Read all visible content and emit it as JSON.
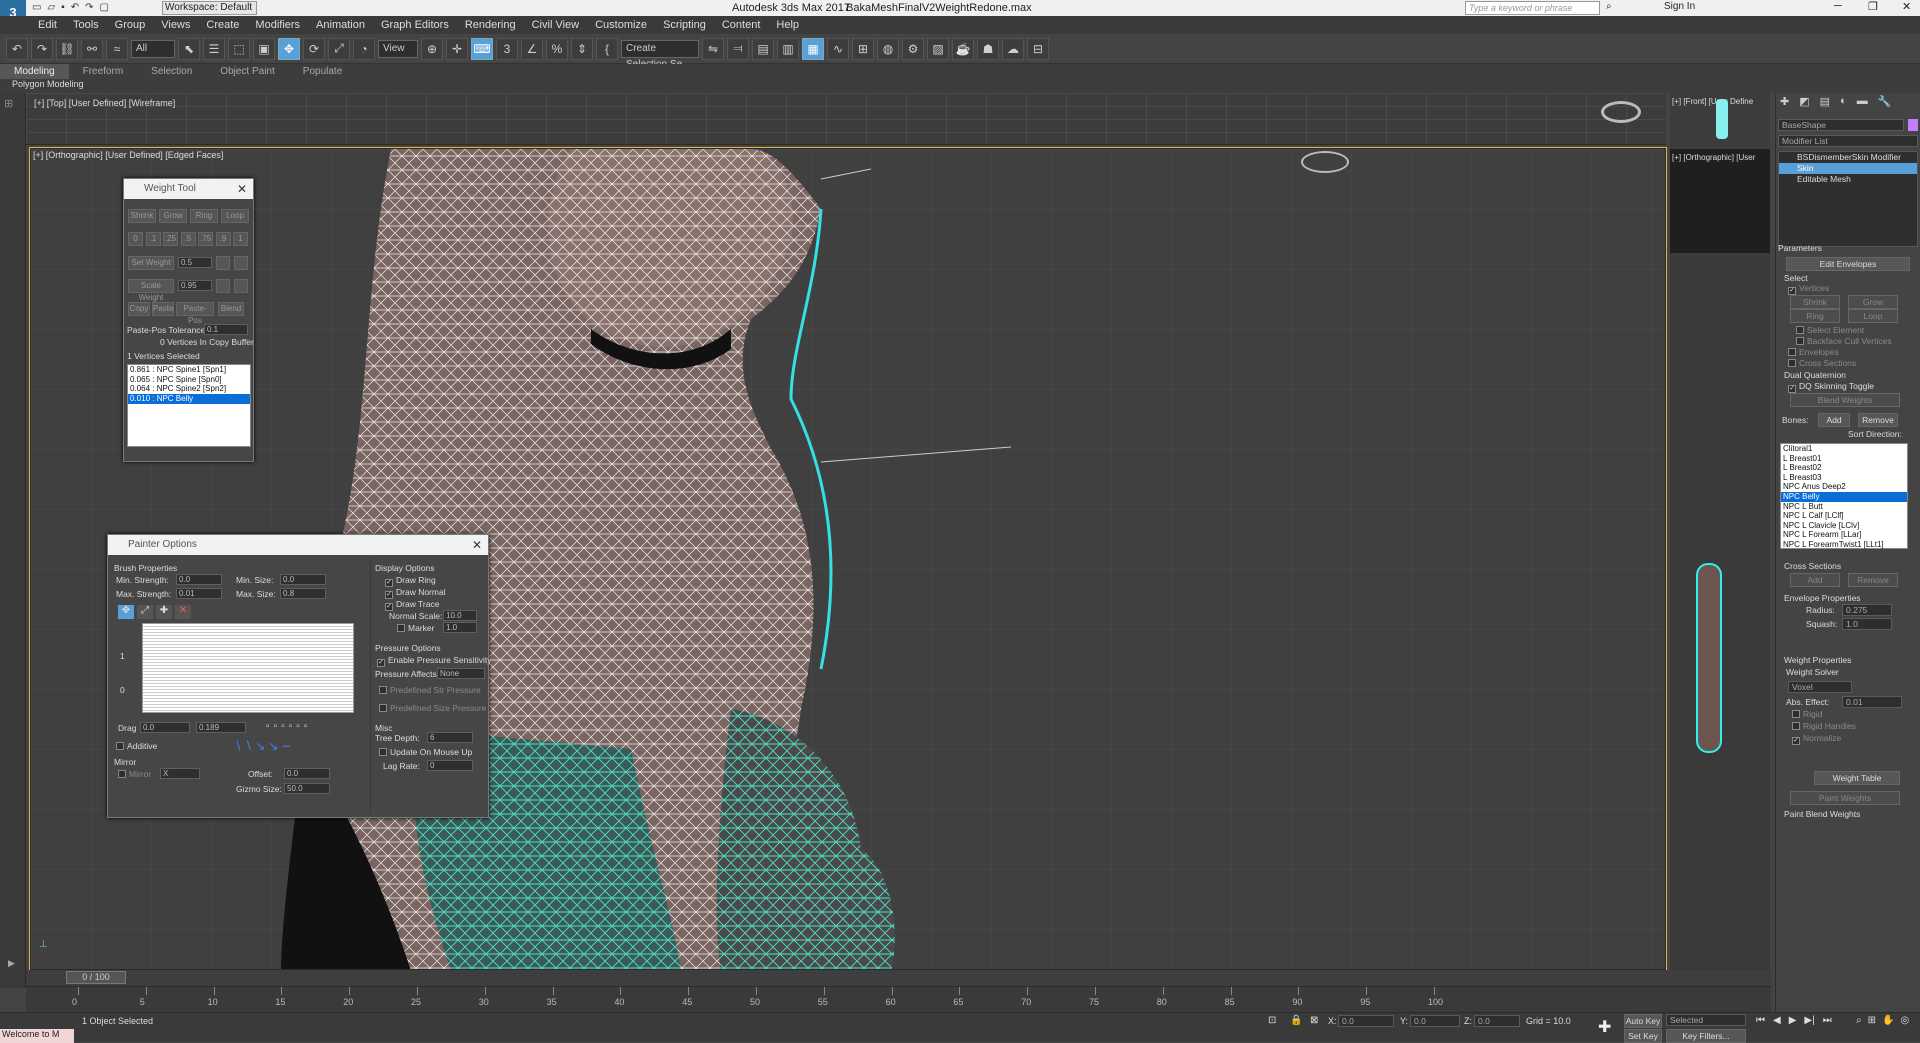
{
  "window": {
    "app_title": "Autodesk 3ds Max 2017",
    "file_name": "BakaMeshFinalV2WeightRedone.max",
    "workspace": "Workspace: Default",
    "search_placeholder": "Type a keyword or phrase",
    "sign_in": "Sign In"
  },
  "menu": [
    "Edit",
    "Tools",
    "Group",
    "Views",
    "Create",
    "Modifiers",
    "Animation",
    "Graph Editors",
    "Rendering",
    "Civil View",
    "Customize",
    "Scripting",
    "Content",
    "Help"
  ],
  "toolbar": {
    "filter_value": "All",
    "ref_coord_value": "View",
    "selection_set_value": "Create Selection Se"
  },
  "ribbon": {
    "tabs": [
      "Modeling",
      "Freeform",
      "Selection",
      "Object Paint",
      "Populate"
    ],
    "active_tab": "Modeling",
    "sub_label": "Polygon Modeling"
  },
  "viewports": {
    "top_label": "[+] [Top] [User Defined] [Wireframe]",
    "main_label": "[+] [Orthographic] [User Defined] [Edged Faces]",
    "right_top_label": "[+] [Front] [User Define",
    "right_mid_label": "[+] [Orthographic] [User"
  },
  "weight_tool": {
    "title": "Weight Tool",
    "row1": [
      "Shrink",
      "Grow",
      "Ring",
      "Loop"
    ],
    "row2": [
      "0",
      ".1",
      ".25",
      ".5",
      ".75",
      ".9",
      "1"
    ],
    "set_weight_label": "Set Weight",
    "set_weight_value": "0.5",
    "scale_weight_label": "Scale Weight",
    "scale_weight_value": "0.95",
    "row5": [
      "Copy",
      "Paste",
      "Paste-Pos",
      "Blend"
    ],
    "paste_pos_label": "Paste-Pos Tolerance",
    "paste_pos_value": "0.1",
    "copy_buffer": "0 Vertices In Copy Buffer",
    "vertices_selected": "1 Vertices Selected",
    "weights": [
      "0.861 : NPC Spine1 [Spn1]",
      "0.065 : NPC Spine [Spn0]",
      "0.064 : NPC Spine2 [Spn2]",
      "0.010 : NPC Belly"
    ],
    "selected_weight_index": 3
  },
  "painter": {
    "title": "Painter Options",
    "brush_properties": "Brush Properties",
    "min_strength_label": "Min. Strength:",
    "min_strength": "0.0",
    "max_strength_label": "Max. Strength:",
    "max_strength": "0.01",
    "min_size_label": "Min. Size:",
    "min_size": "0.0",
    "max_size_label": "Max. Size:",
    "max_size": "0.8",
    "curve_y1": "1",
    "curve_y0": "0",
    "drag_label": "Drag",
    "drag_a": "0.0",
    "drag_b": "0.189",
    "additive": "Additive",
    "mirror_group": "Mirror",
    "mirror_label": "Mirror",
    "mirror_axis": "X",
    "offset_label": "Offset:",
    "offset": "0.0",
    "gizmo_label": "Gizmo Size:",
    "gizmo": "50.0",
    "display_options": "Display Options",
    "draw_ring": "Draw Ring",
    "draw_normal": "Draw Normal",
    "draw_trace": "Draw Trace",
    "normal_scale_label": "Normal Scale:",
    "normal_scale": "10.0",
    "marker_label": "Marker",
    "marker": "1.0",
    "pressure_options": "Pressure Options",
    "enable_pressure": "Enable Pressure Sensitivity",
    "pressure_affects_label": "Pressure Affects",
    "pressure_affects": "None",
    "predefined_str": "Predefined Str Pressure",
    "predefined_size": "Predefined Size Pressure",
    "misc": "Misc",
    "tree_depth_label": "Tree Depth:",
    "tree_depth": "6",
    "update_mouse_up": "Update On Mouse Up",
    "lag_rate_label": "Lag Rate:",
    "lag_rate": "0"
  },
  "command_panel": {
    "object_name": "BaseShape",
    "modifier_list": "Modifier List",
    "stack": [
      "BSDismemberSkin Modifier",
      "Skin",
      "Editable Mesh"
    ],
    "selected_stack_index": 1,
    "parameters": "Parameters",
    "edit_envelopes": "Edit Envelopes",
    "select": "Select",
    "vertices": "Vertices",
    "shrink": "Shrink",
    "grow": "Grow",
    "ring": "Ring",
    "loop": "Loop",
    "select_element": "Select Element",
    "backface": "Backface Cull Vertices",
    "envelopes": "Envelopes",
    "cross_sections_cb": "Cross Sections",
    "dual_quaternion": "Dual Quaternion",
    "dq_toggle": "DQ Skinning Toggle",
    "blend_weights": "Blend Weights",
    "bones_label": "Bones:",
    "add": "Add",
    "remove": "Remove",
    "sort_direction": "Sort Direction:",
    "bones": [
      "Clitoral1",
      "L Breast01",
      "L Breast02",
      "L Breast03",
      "NPC Anus Deep2",
      "NPC Belly",
      "NPC L Butt",
      "NPC L Calf [LClf]",
      "NPC L Clavicle [LClv]",
      "NPC L Forearm [LLar]",
      "NPC L ForearmTwist1 [LLt1]"
    ],
    "selected_bone_index": 5,
    "cross_sections": "Cross Sections",
    "cs_add": "Add",
    "cs_remove": "Remove",
    "envelope_properties": "Envelope Properties",
    "radius_label": "Radius:",
    "radius": "0.275",
    "squash_label": "Squash:",
    "squash": "1.0",
    "weight_properties": "Weight Properties",
    "weight_solver": "Weight Solver",
    "solver_value": "Voxel",
    "abs_effect_label": "Abs. Effect:",
    "abs_effect": "0.01",
    "rigid": "Rigid",
    "rigid_handles": "Rigid Handles",
    "normalize": "Normalize",
    "weight_table": "Weight Table",
    "paint_weights": "Paint Weights",
    "paint_blend": "Paint Blend Weights"
  },
  "timeline": {
    "frame": "0 / 100",
    "ticks": [
      "0",
      "5",
      "10",
      "15",
      "20",
      "25",
      "30",
      "35",
      "40",
      "45",
      "50",
      "55",
      "60",
      "65",
      "70",
      "75",
      "80",
      "85",
      "90",
      "95",
      "100"
    ]
  },
  "status": {
    "selected": "1 Object Selected",
    "welcome": "Welcome to M",
    "x_label": "X:",
    "x": "0.0",
    "y_label": "Y:",
    "y": "0.0",
    "z_label": "Z:",
    "z": "0.0",
    "grid": "Grid = 10.0",
    "auto_key": "Auto Key",
    "selected_mode": "Selected",
    "set_key": "Set Key",
    "key_filters": "Key Filters..."
  }
}
